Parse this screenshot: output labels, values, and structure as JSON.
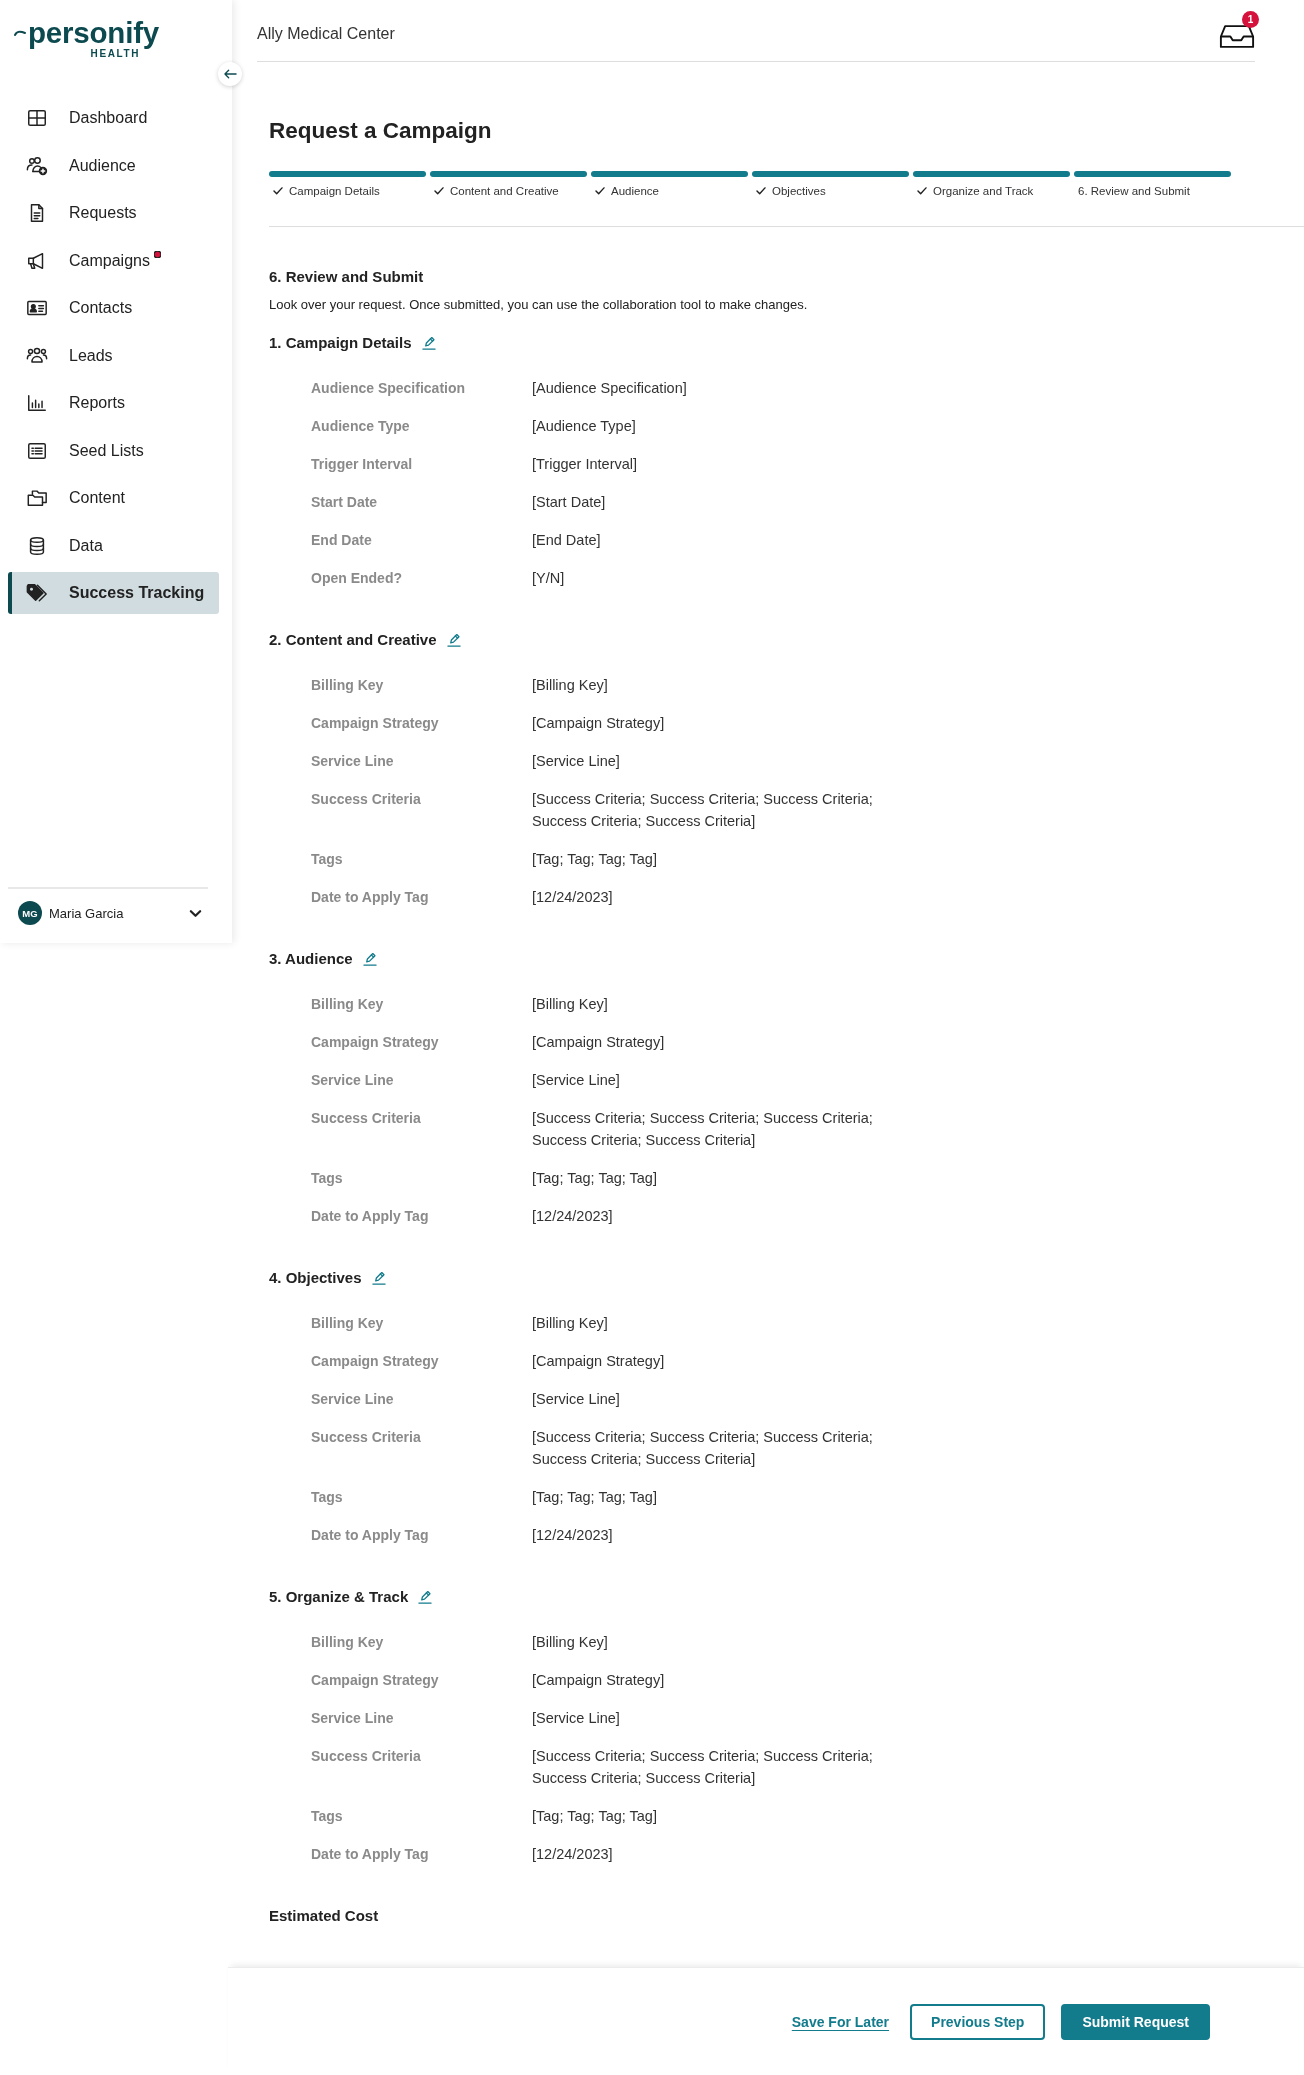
{
  "sidebar": {
    "logo": {
      "wordmark": "personify",
      "tagline": "HEALTH"
    },
    "items": [
      {
        "label": "Dashboard",
        "selected": false,
        "alert": false
      },
      {
        "label": "Audience",
        "selected": false,
        "alert": false
      },
      {
        "label": "Requests",
        "selected": false,
        "alert": false
      },
      {
        "label": "Campaigns",
        "selected": false,
        "alert": true
      },
      {
        "label": "Contacts",
        "selected": false,
        "alert": false
      },
      {
        "label": "Leads",
        "selected": false,
        "alert": false
      },
      {
        "label": "Reports",
        "selected": false,
        "alert": false
      },
      {
        "label": "Seed Lists",
        "selected": false,
        "alert": false
      },
      {
        "label": "Content",
        "selected": false,
        "alert": false
      },
      {
        "label": "Data",
        "selected": false,
        "alert": false
      },
      {
        "label": "Success Tracking",
        "selected": true,
        "alert": false
      }
    ],
    "user": {
      "initials": "MG",
      "name": "Maria Garcia"
    }
  },
  "header": {
    "organization": "Ally Medical Center",
    "inbox_count": "1"
  },
  "page": {
    "title": "Request a Campaign",
    "steps": [
      {
        "label": "Campaign Details",
        "completed": true
      },
      {
        "label": "Content and Creative",
        "completed": true
      },
      {
        "label": "Audience",
        "completed": true
      },
      {
        "label": "Objectives",
        "completed": true
      },
      {
        "label": "Organize and Track",
        "completed": true
      },
      {
        "label": "6. Review and Submit",
        "completed": false
      }
    ],
    "review": {
      "title": "6. Review and Submit",
      "description": "Look over your request. Once submitted, you can use the collaboration tool to make changes.",
      "sections": [
        {
          "title": "1. Campaign Details",
          "fields": [
            {
              "label": "Audience Specification",
              "value": "[Audience Specification]"
            },
            {
              "label": "Audience Type",
              "value": "[Audience Type]"
            },
            {
              "label": "Trigger Interval",
              "value": "[Trigger Interval]"
            },
            {
              "label": "Start Date",
              "value": "[Start Date]"
            },
            {
              "label": "End Date",
              "value": "[End Date]"
            },
            {
              "label": "Open Ended?",
              "value": "[Y/N]"
            }
          ]
        },
        {
          "title": "2. Content and Creative",
          "fields": [
            {
              "label": "Billing Key",
              "value": "[Billing Key]"
            },
            {
              "label": "Campaign Strategy",
              "value": "[Campaign Strategy]"
            },
            {
              "label": "Service Line",
              "value": "[Service Line]"
            },
            {
              "label": "Success Criteria",
              "value": "[Success Criteria; Success Criteria; Success Criteria; Success Criteria; Success Criteria]"
            },
            {
              "label": "Tags",
              "value": "[Tag; Tag; Tag; Tag]"
            },
            {
              "label": "Date to Apply Tag",
              "value": "[12/24/2023]"
            }
          ]
        },
        {
          "title": "3. Audience",
          "fields": [
            {
              "label": "Billing Key",
              "value": "[Billing Key]"
            },
            {
              "label": "Campaign Strategy",
              "value": "[Campaign Strategy]"
            },
            {
              "label": "Service Line",
              "value": "[Service Line]"
            },
            {
              "label": "Success Criteria",
              "value": "[Success Criteria; Success Criteria; Success Criteria; Success Criteria; Success Criteria]"
            },
            {
              "label": "Tags",
              "value": "[Tag; Tag; Tag; Tag]"
            },
            {
              "label": "Date to Apply Tag",
              "value": "[12/24/2023]"
            }
          ]
        },
        {
          "title": "4. Objectives",
          "fields": [
            {
              "label": "Billing Key",
              "value": "[Billing Key]"
            },
            {
              "label": "Campaign Strategy",
              "value": "[Campaign Strategy]"
            },
            {
              "label": "Service Line",
              "value": "[Service Line]"
            },
            {
              "label": "Success Criteria",
              "value": "[Success Criteria; Success Criteria; Success Criteria; Success Criteria; Success Criteria]"
            },
            {
              "label": "Tags",
              "value": "[Tag; Tag; Tag; Tag]"
            },
            {
              "label": "Date to Apply Tag",
              "value": "[12/24/2023]"
            }
          ]
        },
        {
          "title": "5. Organize & Track",
          "fields": [
            {
              "label": "Billing Key",
              "value": "[Billing Key]"
            },
            {
              "label": "Campaign Strategy",
              "value": "[Campaign Strategy]"
            },
            {
              "label": "Service Line",
              "value": "[Service Line]"
            },
            {
              "label": "Success Criteria",
              "value": "[Success Criteria; Success Criteria; Success Criteria; Success Criteria; Success Criteria]"
            },
            {
              "label": "Tags",
              "value": "[Tag; Tag; Tag; Tag]"
            },
            {
              "label": "Date to Apply Tag",
              "value": "[12/24/2023]"
            }
          ]
        }
      ],
      "estimated_cost_title": "Estimated Cost"
    }
  },
  "footer": {
    "actions": [
      {
        "label": "Save For Later",
        "kind": "link"
      },
      {
        "label": "Previous Step",
        "kind": "secondary"
      },
      {
        "label": "Submit Request",
        "kind": "primary"
      }
    ]
  }
}
